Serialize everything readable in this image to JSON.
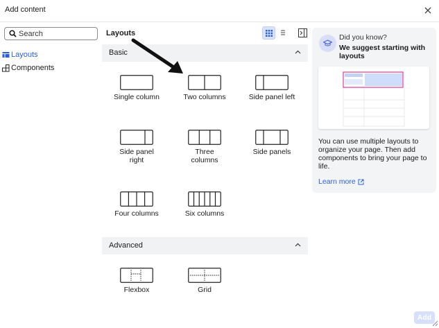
{
  "dialog": {
    "title": "Add content"
  },
  "search": {
    "placeholder": "Search"
  },
  "sidebar": {
    "items": [
      {
        "label": "Layouts"
      },
      {
        "label": "Components"
      }
    ]
  },
  "main": {
    "title": "Layouts",
    "sections": [
      {
        "label": "Basic",
        "tiles": [
          {
            "label": "Single column"
          },
          {
            "label": "Two columns"
          },
          {
            "label": "Side panel left"
          },
          {
            "label": "Side panel right"
          },
          {
            "label": "Three columns"
          },
          {
            "label": "Side panels"
          },
          {
            "label": "Four columns"
          },
          {
            "label": "Six columns"
          }
        ]
      },
      {
        "label": "Advanced",
        "tiles": [
          {
            "label": "Flexbox"
          },
          {
            "label": "Grid"
          }
        ]
      }
    ]
  },
  "tip": {
    "kicker": "Did you know?",
    "headline": "We suggest starting with layouts",
    "body": "You can use multiple layouts to organize your page. Then add components to bring your page to life.",
    "link": "Learn more"
  },
  "footer": {
    "add_label": "Add"
  },
  "colors": {
    "accent": "#2b5fd9",
    "highlight": "#e0389a",
    "preview_fill": "#cfdcfa"
  },
  "icons": [
    "close-icon",
    "search-icon",
    "layouts-icon",
    "components-icon",
    "grid-view-icon",
    "list-view-icon",
    "panel-toggle-icon",
    "chevron-up-icon",
    "graduation-cap-icon",
    "external-link-icon"
  ]
}
